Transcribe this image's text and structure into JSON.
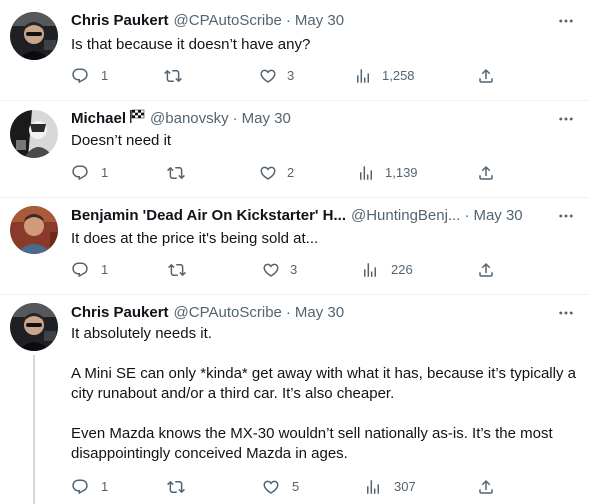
{
  "tweets": [
    {
      "name": "Chris Paukert",
      "handle": "@CPAutoScribe",
      "date": "May 30",
      "text": [
        "Is that because it doesn’t have any?"
      ],
      "replies": "1",
      "retweets": "",
      "likes": "3",
      "views": "1,258"
    },
    {
      "name": "Michael",
      "handle": "@banovsky",
      "date": "May 30",
      "text": [
        "Doesn’t need it"
      ],
      "replies": "1",
      "retweets": "",
      "likes": "2",
      "views": "1,139"
    },
    {
      "name": "Benjamin 'Dead Air On Kickstarter' H...",
      "handle": "@HuntingBenj...",
      "date": "May 30",
      "text": [
        "It does at the price it's being sold at..."
      ],
      "replies": "1",
      "retweets": "",
      "likes": "3",
      "views": "226"
    },
    {
      "name": "Chris Paukert",
      "handle": "@CPAutoScribe",
      "date": "May 30",
      "text": [
        "It absolutely needs it.",
        "A Mini SE can only *kinda* get away with what it has, because it’s typically a city runabout and/or a third car. It’s also cheaper.",
        "Even Mazda knows the MX-30 wouldn’t sell nationally as-is. It’s the most disappointingly conceived Mazda in ages."
      ],
      "replies": "1",
      "retweets": "",
      "likes": "5",
      "views": "307"
    }
  ],
  "separator": "·",
  "icons": {
    "reply": "reply-icon",
    "retweet": "retweet-icon",
    "like": "heart-icon",
    "views": "views-chart-icon",
    "share": "share-icon",
    "more": "more-options-icon"
  },
  "colors": {
    "text": "#0f1419",
    "secondary": "#536471",
    "thread_line": "#cfd9de"
  }
}
